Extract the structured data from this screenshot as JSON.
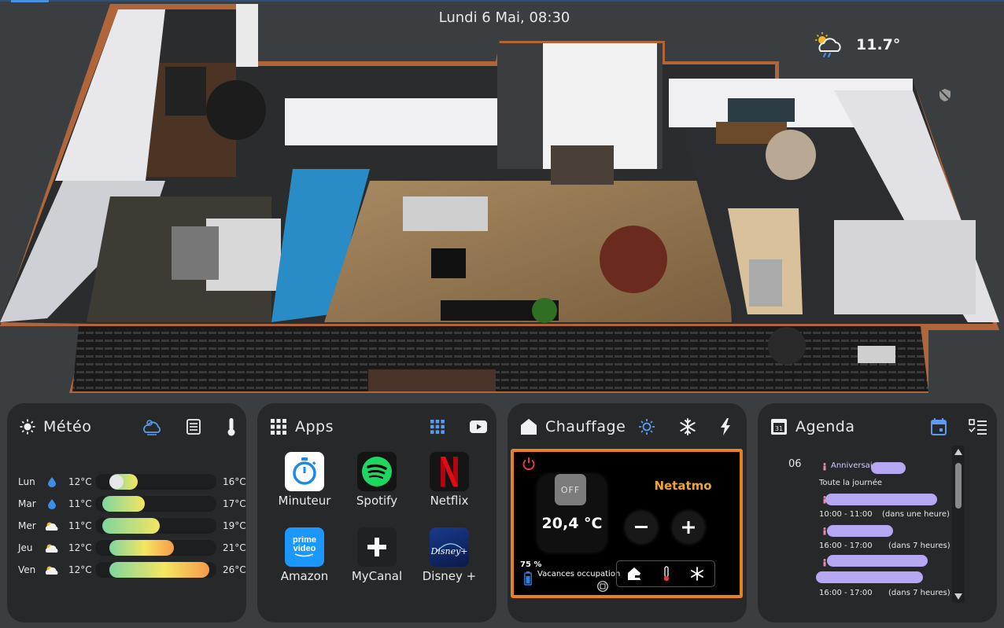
{
  "header": {
    "datetime": "Lundi 6 Mai, 08:30",
    "outdoor_temp": "11.7°"
  },
  "meteo": {
    "title": "Météo",
    "forecast": [
      {
        "day": "Lun",
        "icon": "raindrop-icon",
        "min": "12°C",
        "max": "16°C",
        "min_value": 12,
        "max_value": 16
      },
      {
        "day": "Mar",
        "icon": "raindrop-icon",
        "min": "11°C",
        "max": "17°C",
        "min_value": 11,
        "max_value": 17
      },
      {
        "day": "Mer",
        "icon": "partly-cloudy-icon",
        "min": "11°C",
        "max": "19°C",
        "min_value": 11,
        "max_value": 19
      },
      {
        "day": "Jeu",
        "icon": "partly-cloudy-icon",
        "min": "12°C",
        "max": "21°C",
        "min_value": 12,
        "max_value": 21
      },
      {
        "day": "Ven",
        "icon": "partly-cloudy-icon",
        "min": "12°C",
        "max": "26°C",
        "min_value": 12,
        "max_value": 26
      }
    ]
  },
  "apps": {
    "title": "Apps",
    "items": [
      {
        "label": "Minuteur",
        "icon": "stopwatch-icon"
      },
      {
        "label": "Spotify",
        "icon": "spotify-icon"
      },
      {
        "label": "Netflix",
        "icon": "netflix-icon"
      },
      {
        "label": "Amazon",
        "icon": "prime-video-icon",
        "logo_line1": "prime",
        "logo_line2": "video"
      },
      {
        "label": "MyCanal",
        "icon": "plus-icon"
      },
      {
        "label": "Disney +",
        "icon": "disney-plus-icon",
        "logo_text": "Disney+"
      }
    ]
  },
  "chauffage": {
    "title": "Chauffage",
    "state": "OFF",
    "current_temp": "20,4 °C",
    "device": "Netatmo",
    "battery": "75 %",
    "mode": "Vacances occupation",
    "accent": "#e8821e"
  },
  "agenda": {
    "title": "Agenda",
    "day": "06",
    "events": [
      {
        "title": "Anniversair",
        "time": "Toute la journée",
        "relative": ""
      },
      {
        "title": "",
        "time": "10:00 - 11:00",
        "relative": "(dans une heure)"
      },
      {
        "title": "",
        "time": "16:00 - 17:00",
        "relative": "(dans 7 heures)"
      },
      {
        "title": "",
        "time": "16:00 - 17:00",
        "relative": "(dans 7 heures)"
      }
    ]
  }
}
